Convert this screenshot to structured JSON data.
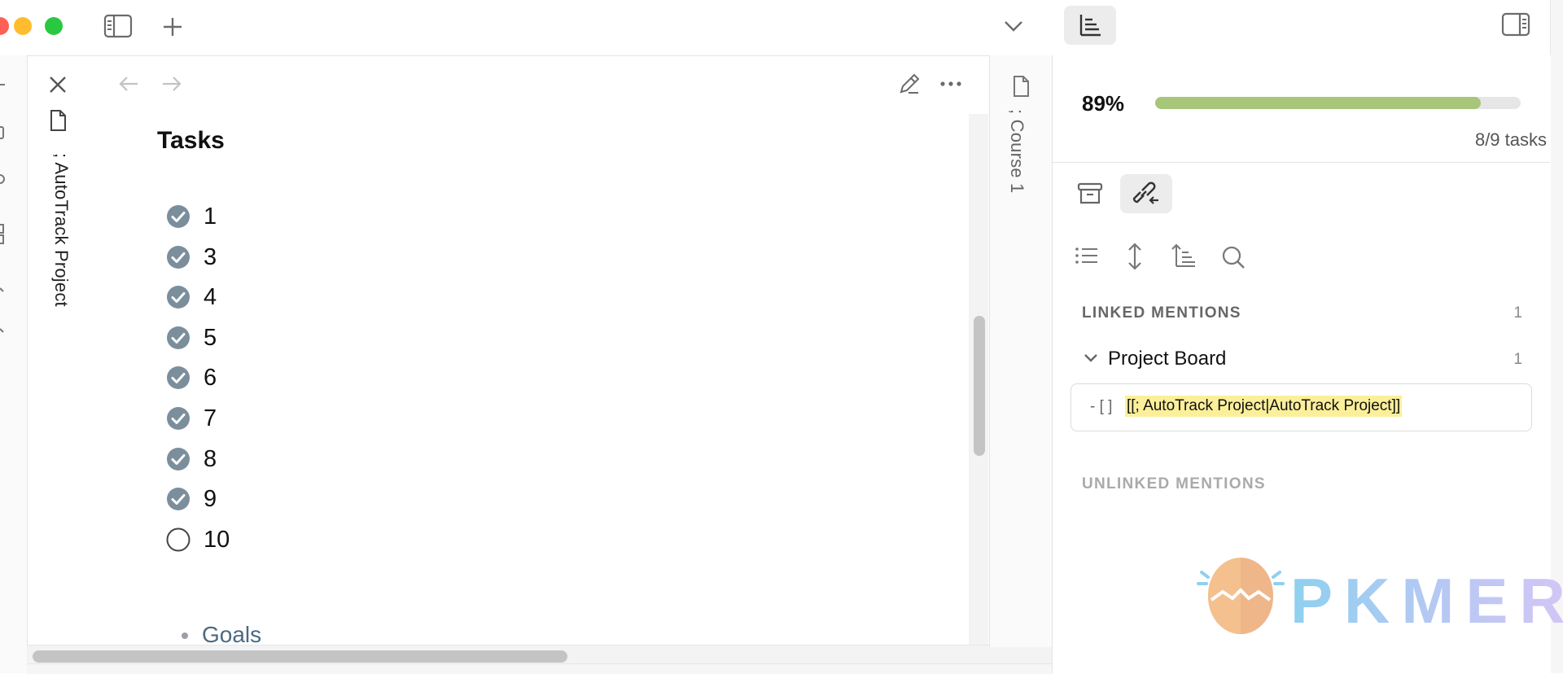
{
  "title_bar": {
    "icons": [
      "toggle-left-sidebar-icon",
      "new-tab-icon",
      "tab-list-chevron-icon"
    ]
  },
  "editor": {
    "pane_title": "; AutoTrack Project",
    "heading": "Tasks",
    "tasks": [
      {
        "label": "1",
        "done": true
      },
      {
        "label": "3",
        "done": true
      },
      {
        "label": "4",
        "done": true
      },
      {
        "label": "5",
        "done": true
      },
      {
        "label": "6",
        "done": true
      },
      {
        "label": "7",
        "done": true
      },
      {
        "label": "8",
        "done": true
      },
      {
        "label": "9",
        "done": true
      },
      {
        "label": "10",
        "done": false
      }
    ],
    "bullet_item": "Goals"
  },
  "second_pane": {
    "title": "; Course 1"
  },
  "sidebar": {
    "progress": {
      "percent_label": "89%",
      "fraction": 0.89,
      "count_label": "8/9 tasks",
      "bar_color": "#a7c67a"
    },
    "linked": {
      "heading": "LINKED MENTIONS",
      "count": "1",
      "group_title": "Project Board",
      "group_count": "1",
      "mention_prefix": "- [ ]",
      "mention_link": "[[; AutoTrack Project|AutoTrack Project]]",
      "highlight_color": "#fbef9a"
    },
    "unlinked": {
      "heading": "UNLINKED MENTIONS"
    }
  },
  "watermark": {
    "text": "PKMER"
  }
}
